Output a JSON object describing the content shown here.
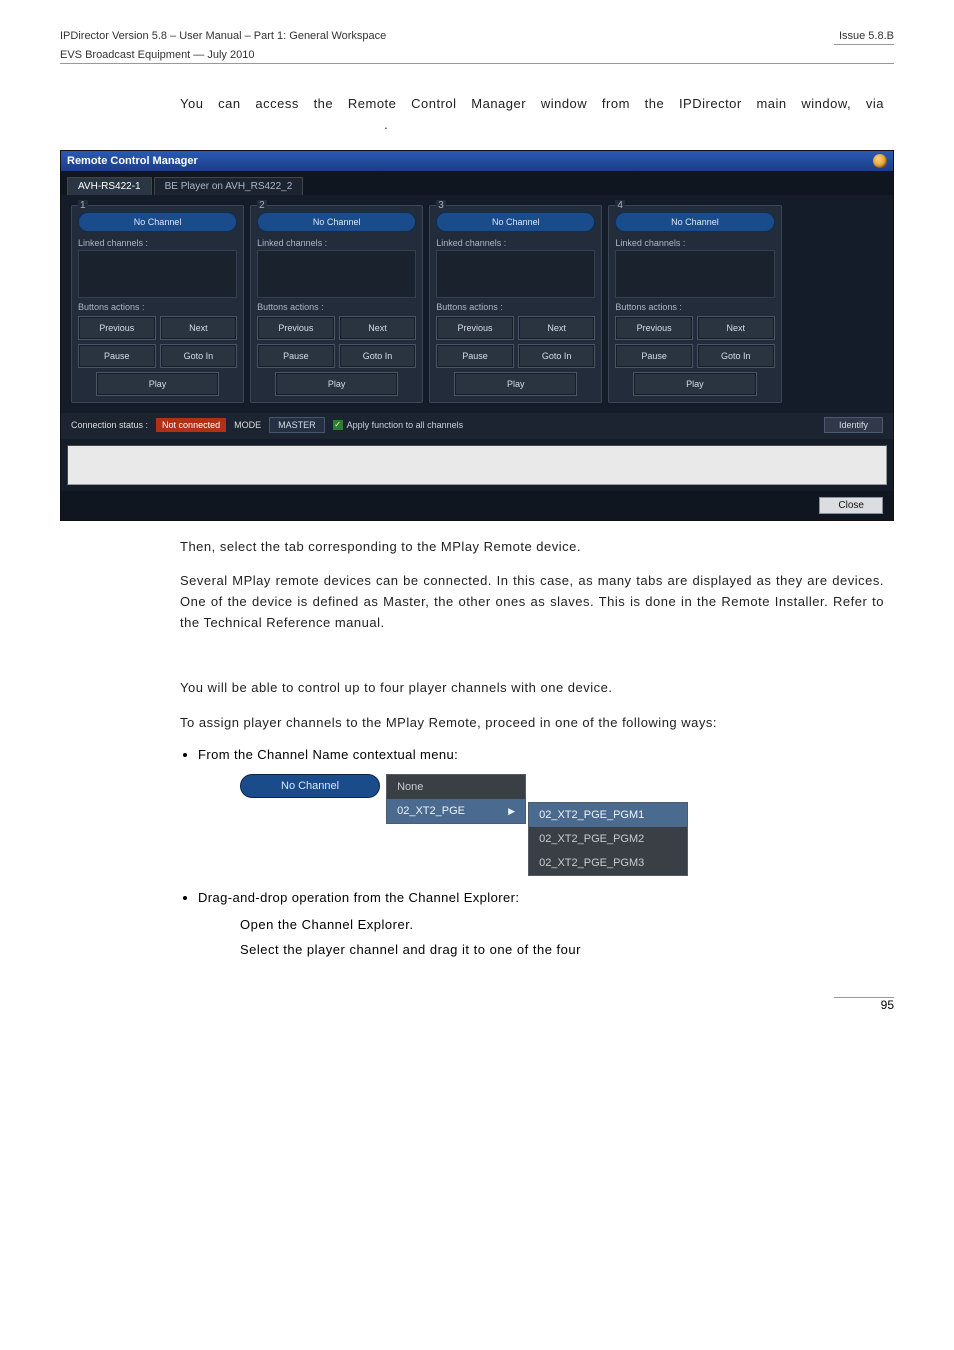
{
  "header": {
    "left_line1": "IPDirector Version 5.8 – User Manual – Part 1: General Workspace",
    "left_line2": "EVS Broadcast Equipment  — July 2010",
    "right": "Issue 5.8.B"
  },
  "intro_text": "You can access the Remote Control Manager window from the IPDirector main window, via",
  "intro_period": ".",
  "app": {
    "title": "Remote Control Manager",
    "tabs": [
      "AVH-RS422-1",
      "BE Player on AVH_RS422_2"
    ],
    "panels": [
      {
        "num": "1",
        "channel": "No Channel"
      },
      {
        "num": "2",
        "channel": "No Channel"
      },
      {
        "num": "3",
        "channel": "No Channel"
      },
      {
        "num": "4",
        "channel": "No Channel"
      }
    ],
    "linked_label": "Linked channels :",
    "buttons_label": "Buttons actions :",
    "btn_previous": "Previous",
    "btn_next": "Next",
    "btn_pause": "Pause",
    "btn_gotoin": "Goto In",
    "btn_play": "Play",
    "status_label": "Connection status :",
    "status_value": "Not connected",
    "mode_label": "MODE",
    "mode_value": "MASTER",
    "apply_label": "Apply function to all channels",
    "identify": "Identify",
    "close": "Close"
  },
  "p_then": "Then, select the tab corresponding to the MPlay Remote device.",
  "p_several": "Several MPlay remote devices can be connected. In this case, as many tabs are displayed as they are devices. One of the device is defined as Master, the other ones as slaves. This is done in the Remote Installer. Refer to the Technical Reference manual.",
  "p_control": "You will be able to control up to four player channels with one device.",
  "p_assign": "To assign player channels to the MPlay Remote, proceed in one of the following ways:",
  "bullet1": "From the Channel Name contextual menu:",
  "ctx": {
    "button": "No Channel",
    "menu": [
      "None",
      "02_XT2_PGE"
    ],
    "submenu": [
      "02_XT2_PGE_PGM1",
      "02_XT2_PGE_PGM2",
      "02_XT2_PGE_PGM3"
    ]
  },
  "bullet2": "Drag-and-drop operation from the Channel Explorer:",
  "sub1": "Open the Channel Explorer.",
  "sub2": "Select the player channel and drag it to one of the four",
  "page_number": "95"
}
